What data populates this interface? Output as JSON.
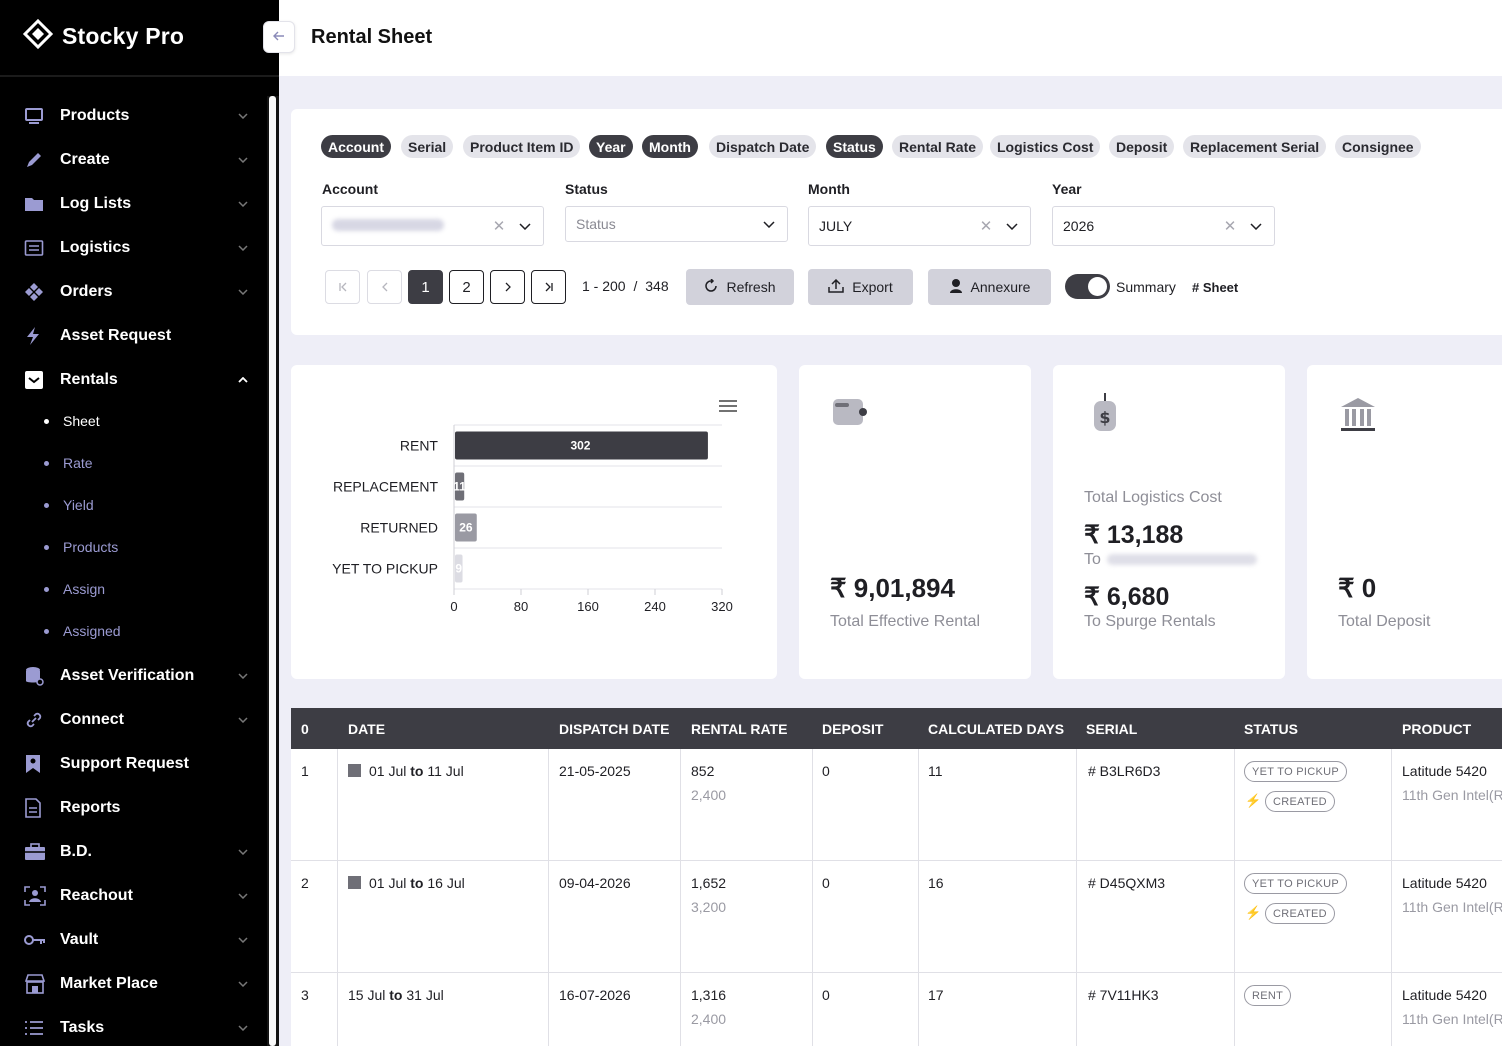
{
  "app": {
    "name": "Stocky Pro"
  },
  "page": {
    "title": "Rental Sheet"
  },
  "sidebar": {
    "items": [
      {
        "label": "Products",
        "icon": "monitor-icon",
        "chevron": "down"
      },
      {
        "label": "Create",
        "icon": "pen-icon",
        "chevron": "down"
      },
      {
        "label": "Log Lists",
        "icon": "folder-icon",
        "chevron": "down"
      },
      {
        "label": "Logistics",
        "icon": "list-icon",
        "chevron": "down"
      },
      {
        "label": "Orders",
        "icon": "grid-diamond-icon",
        "chevron": "down"
      },
      {
        "label": "Asset Request",
        "icon": "bolt-icon",
        "chevron": ""
      },
      {
        "label": "Rentals",
        "icon": "inbox-icon",
        "chevron": "up"
      },
      {
        "label": "Asset Verification",
        "icon": "database-icon",
        "chevron": "down"
      },
      {
        "label": "Connect",
        "icon": "link-icon",
        "chevron": "down"
      },
      {
        "label": "Support Request",
        "icon": "bookmark-icon",
        "chevron": ""
      },
      {
        "label": "Reports",
        "icon": "document-icon",
        "chevron": ""
      },
      {
        "label": "B.D.",
        "icon": "briefcase-icon",
        "chevron": "down"
      },
      {
        "label": "Reachout",
        "icon": "user-frame-icon",
        "chevron": "down"
      },
      {
        "label": "Vault",
        "icon": "key-icon",
        "chevron": "down"
      },
      {
        "label": "Market Place",
        "icon": "store-icon",
        "chevron": "down"
      },
      {
        "label": "Tasks",
        "icon": "tasks-icon",
        "chevron": "down"
      }
    ],
    "rentals_sub": [
      "Sheet",
      "Rate",
      "Yield",
      "Products",
      "Assign",
      "Assigned"
    ]
  },
  "filters": {
    "chips": [
      {
        "label": "Account",
        "active": true
      },
      {
        "label": "Serial",
        "active": false
      },
      {
        "label": "Product Item ID",
        "active": false
      },
      {
        "label": "Year",
        "active": true
      },
      {
        "label": "Month",
        "active": true
      },
      {
        "label": "Dispatch Date",
        "active": false
      },
      {
        "label": "Status",
        "active": true
      },
      {
        "label": "Rental Rate",
        "active": false
      },
      {
        "label": "Logistics Cost",
        "active": false
      },
      {
        "label": "Deposit",
        "active": false
      },
      {
        "label": "Replacement Serial",
        "active": false
      },
      {
        "label": "Consignee",
        "active": false
      }
    ],
    "account": {
      "label": "Account"
    },
    "status": {
      "label": "Status",
      "placeholder": "Status"
    },
    "month": {
      "label": "Month",
      "value": "JULY"
    },
    "year": {
      "label": "Year",
      "value": "2026"
    }
  },
  "pagination": {
    "pages": [
      "1",
      "2"
    ],
    "current": "1",
    "range": "1 - 200",
    "sep": "/",
    "total": "348"
  },
  "actions": {
    "refresh": "Refresh",
    "export": "Export",
    "annexure": "Annexure",
    "summary": "Summary",
    "sheet": "# Sheet",
    "summary_on": true
  },
  "chart_data": {
    "type": "bar",
    "orientation": "horizontal",
    "categories": [
      "RENT",
      "REPLACEMENT",
      "RETURNED",
      "YET TO PICKUP"
    ],
    "values": [
      302,
      11,
      26,
      9
    ],
    "data_labels": [
      "302",
      "11",
      "26",
      "9"
    ],
    "xlim": [
      0,
      320
    ],
    "xticks": [
      "0",
      "80",
      "160",
      "240",
      "320"
    ],
    "colors": [
      "#3d3d44",
      "#6f6f77",
      "#9a9aa3",
      "#dcdce3"
    ],
    "grid": true,
    "title": "",
    "xlabel": "",
    "ylabel": ""
  },
  "cards": {
    "rental": {
      "amount": "₹ 9,01,894",
      "caption": "Total Effective Rental"
    },
    "logistics": {
      "title": "Total Logistics Cost",
      "amount": "₹ 13,188",
      "to_prefix": "To",
      "spurge_amount": "₹ 6,680",
      "spurge_caption": "To Spurge Rentals"
    },
    "deposit": {
      "amount": "₹ 0",
      "caption": "Total Deposit"
    }
  },
  "table": {
    "columns": [
      "0",
      "DATE",
      "DISPATCH DATE",
      "RENTAL RATE",
      "DEPOSIT",
      "CALCULATED DAYS",
      "SERIAL",
      "STATUS",
      "PRODUCT"
    ],
    "rows": [
      {
        "no": "1",
        "from": "01 Jul",
        "to_word": "to",
        "until": "11 Jul",
        "dispatch": "21-05-2025",
        "rate": "852",
        "rate_sub": "2,400",
        "deposit": "0",
        "days": "11",
        "serial": "# B3LR6D3",
        "status": "YET TO PICKUP",
        "status2": "CREATED",
        "product": "Latitude 5420",
        "product_sub": "11th Gen Intel(R"
      },
      {
        "no": "2",
        "from": "01 Jul",
        "to_word": "to",
        "until": "16 Jul",
        "dispatch": "09-04-2026",
        "rate": "1,652",
        "rate_sub": "3,200",
        "deposit": "0",
        "days": "16",
        "serial": "# D45QXM3",
        "status": "YET TO PICKUP",
        "status2": "CREATED",
        "product": "Latitude 5420",
        "product_sub": "11th Gen Intel(R"
      },
      {
        "no": "3",
        "from": "15 Jul",
        "to_word": "to",
        "until": "31 Jul",
        "dispatch": "16-07-2026",
        "rate": "1,316",
        "rate_sub": "2,400",
        "deposit": "0",
        "days": "17",
        "serial": "# 7V11HK3",
        "status": "RENT",
        "status2": "",
        "product": "Latitude 5420",
        "product_sub": "11th Gen Intel(R"
      }
    ]
  }
}
